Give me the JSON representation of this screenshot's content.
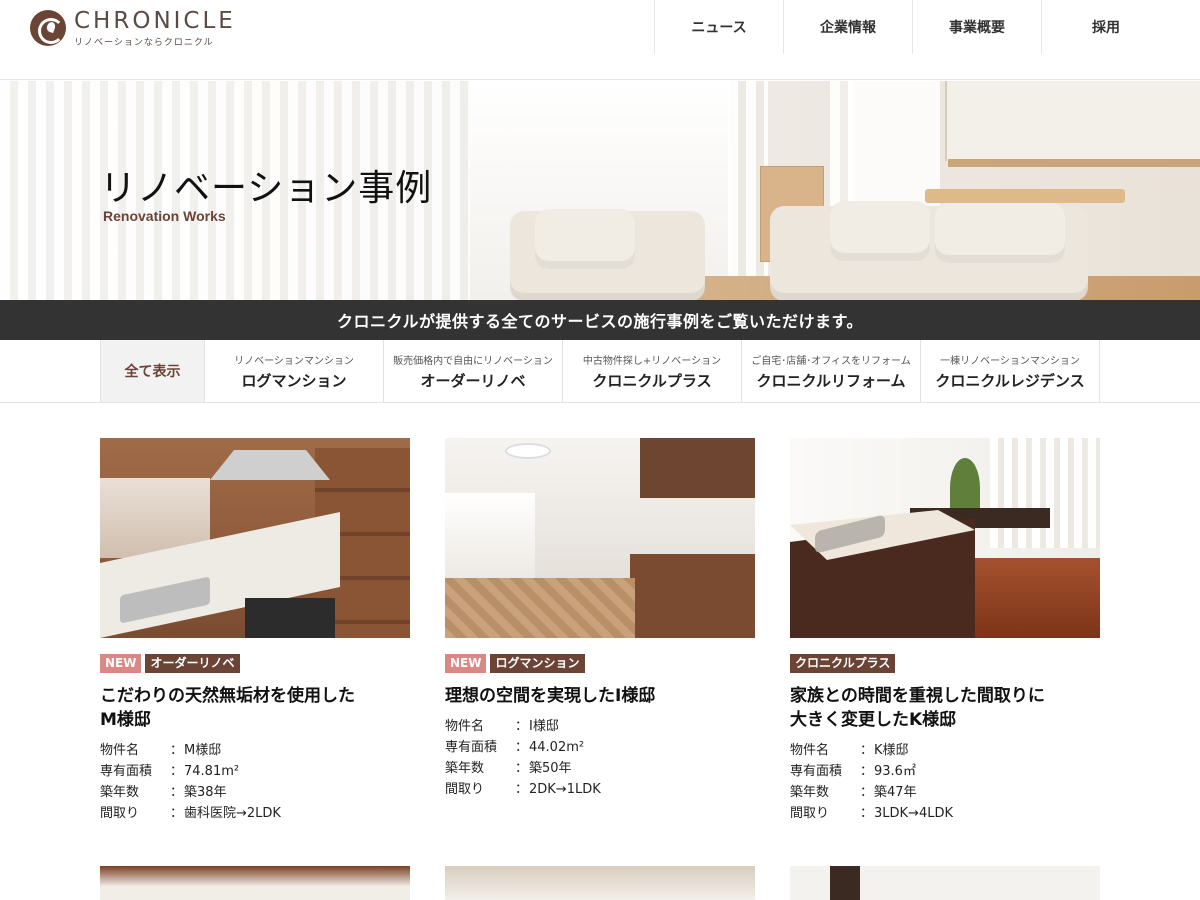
{
  "header": {
    "logo_name": "CHRONICLE",
    "logo_tagline": "リノベーションならクロニクル",
    "nav": [
      "ニュース",
      "企業情報",
      "事業概要",
      "採用"
    ]
  },
  "hero": {
    "title": "リノベーション事例",
    "subtitle": "Renovation Works"
  },
  "tagline": "クロニクルが提供する全てのサービスの施行事例をご覧いただけます。",
  "filter": {
    "all_label": "全て表示",
    "items": [
      {
        "small": "リノベーションマンション",
        "big": "ログマンション"
      },
      {
        "small": "販売価格内で自由にリノベーション",
        "big": "オーダーリノベ"
      },
      {
        "small": "中古物件探し+リノベーション",
        "big": "クロニクルプラス"
      },
      {
        "small": "ご自宅･店舗･オフィスをリフォーム",
        "big": "クロニクルリフォーム"
      },
      {
        "small": "一棟リノベーションマンション",
        "big": "クロニクルレジデンス"
      }
    ]
  },
  "cards": [
    {
      "new_label": "NEW",
      "category": "オーダーリノベ",
      "title_line1": "こだわりの天然無垢材を使用した",
      "title_line2": "M様邸",
      "specs": [
        {
          "label": "物件名",
          "sep": "：",
          "value": "M様邸"
        },
        {
          "label": "専有面積",
          "sep": "：",
          "value": "74.81m²"
        },
        {
          "label": "築年数",
          "sep": "：",
          "value": "築38年"
        },
        {
          "label": "間取り",
          "sep": "：",
          "value": "歯科医院→2LDK"
        }
      ]
    },
    {
      "new_label": "NEW",
      "category": "ログマンション",
      "title_line1": "理想の空間を実現したI様邸",
      "title_line2": "",
      "specs": [
        {
          "label": "物件名",
          "sep": "：",
          "value": "I様邸"
        },
        {
          "label": "専有面積",
          "sep": "：",
          "value": "44.02m²"
        },
        {
          "label": "築年数",
          "sep": "：",
          "value": "築50年"
        },
        {
          "label": "間取り",
          "sep": "：",
          "value": "2DK→1LDK"
        }
      ]
    },
    {
      "new_label": "",
      "category": "クロニクルプラス",
      "title_line1": "家族との時間を重視した間取りに",
      "title_line2": "大きく変更したK様邸",
      "specs": [
        {
          "label": "物件名",
          "sep": "：",
          "value": "K様邸"
        },
        {
          "label": "専有面積",
          "sep": "：",
          "value": "93.6㎡"
        },
        {
          "label": "築年数",
          "sep": "：",
          "value": "築47年"
        },
        {
          "label": "間取り",
          "sep": "：",
          "value": "3LDK→4LDK"
        }
      ]
    }
  ],
  "colors": {
    "brand": "#6b4436",
    "new_badge": "#d98886",
    "tagline_bg": "#333333"
  }
}
